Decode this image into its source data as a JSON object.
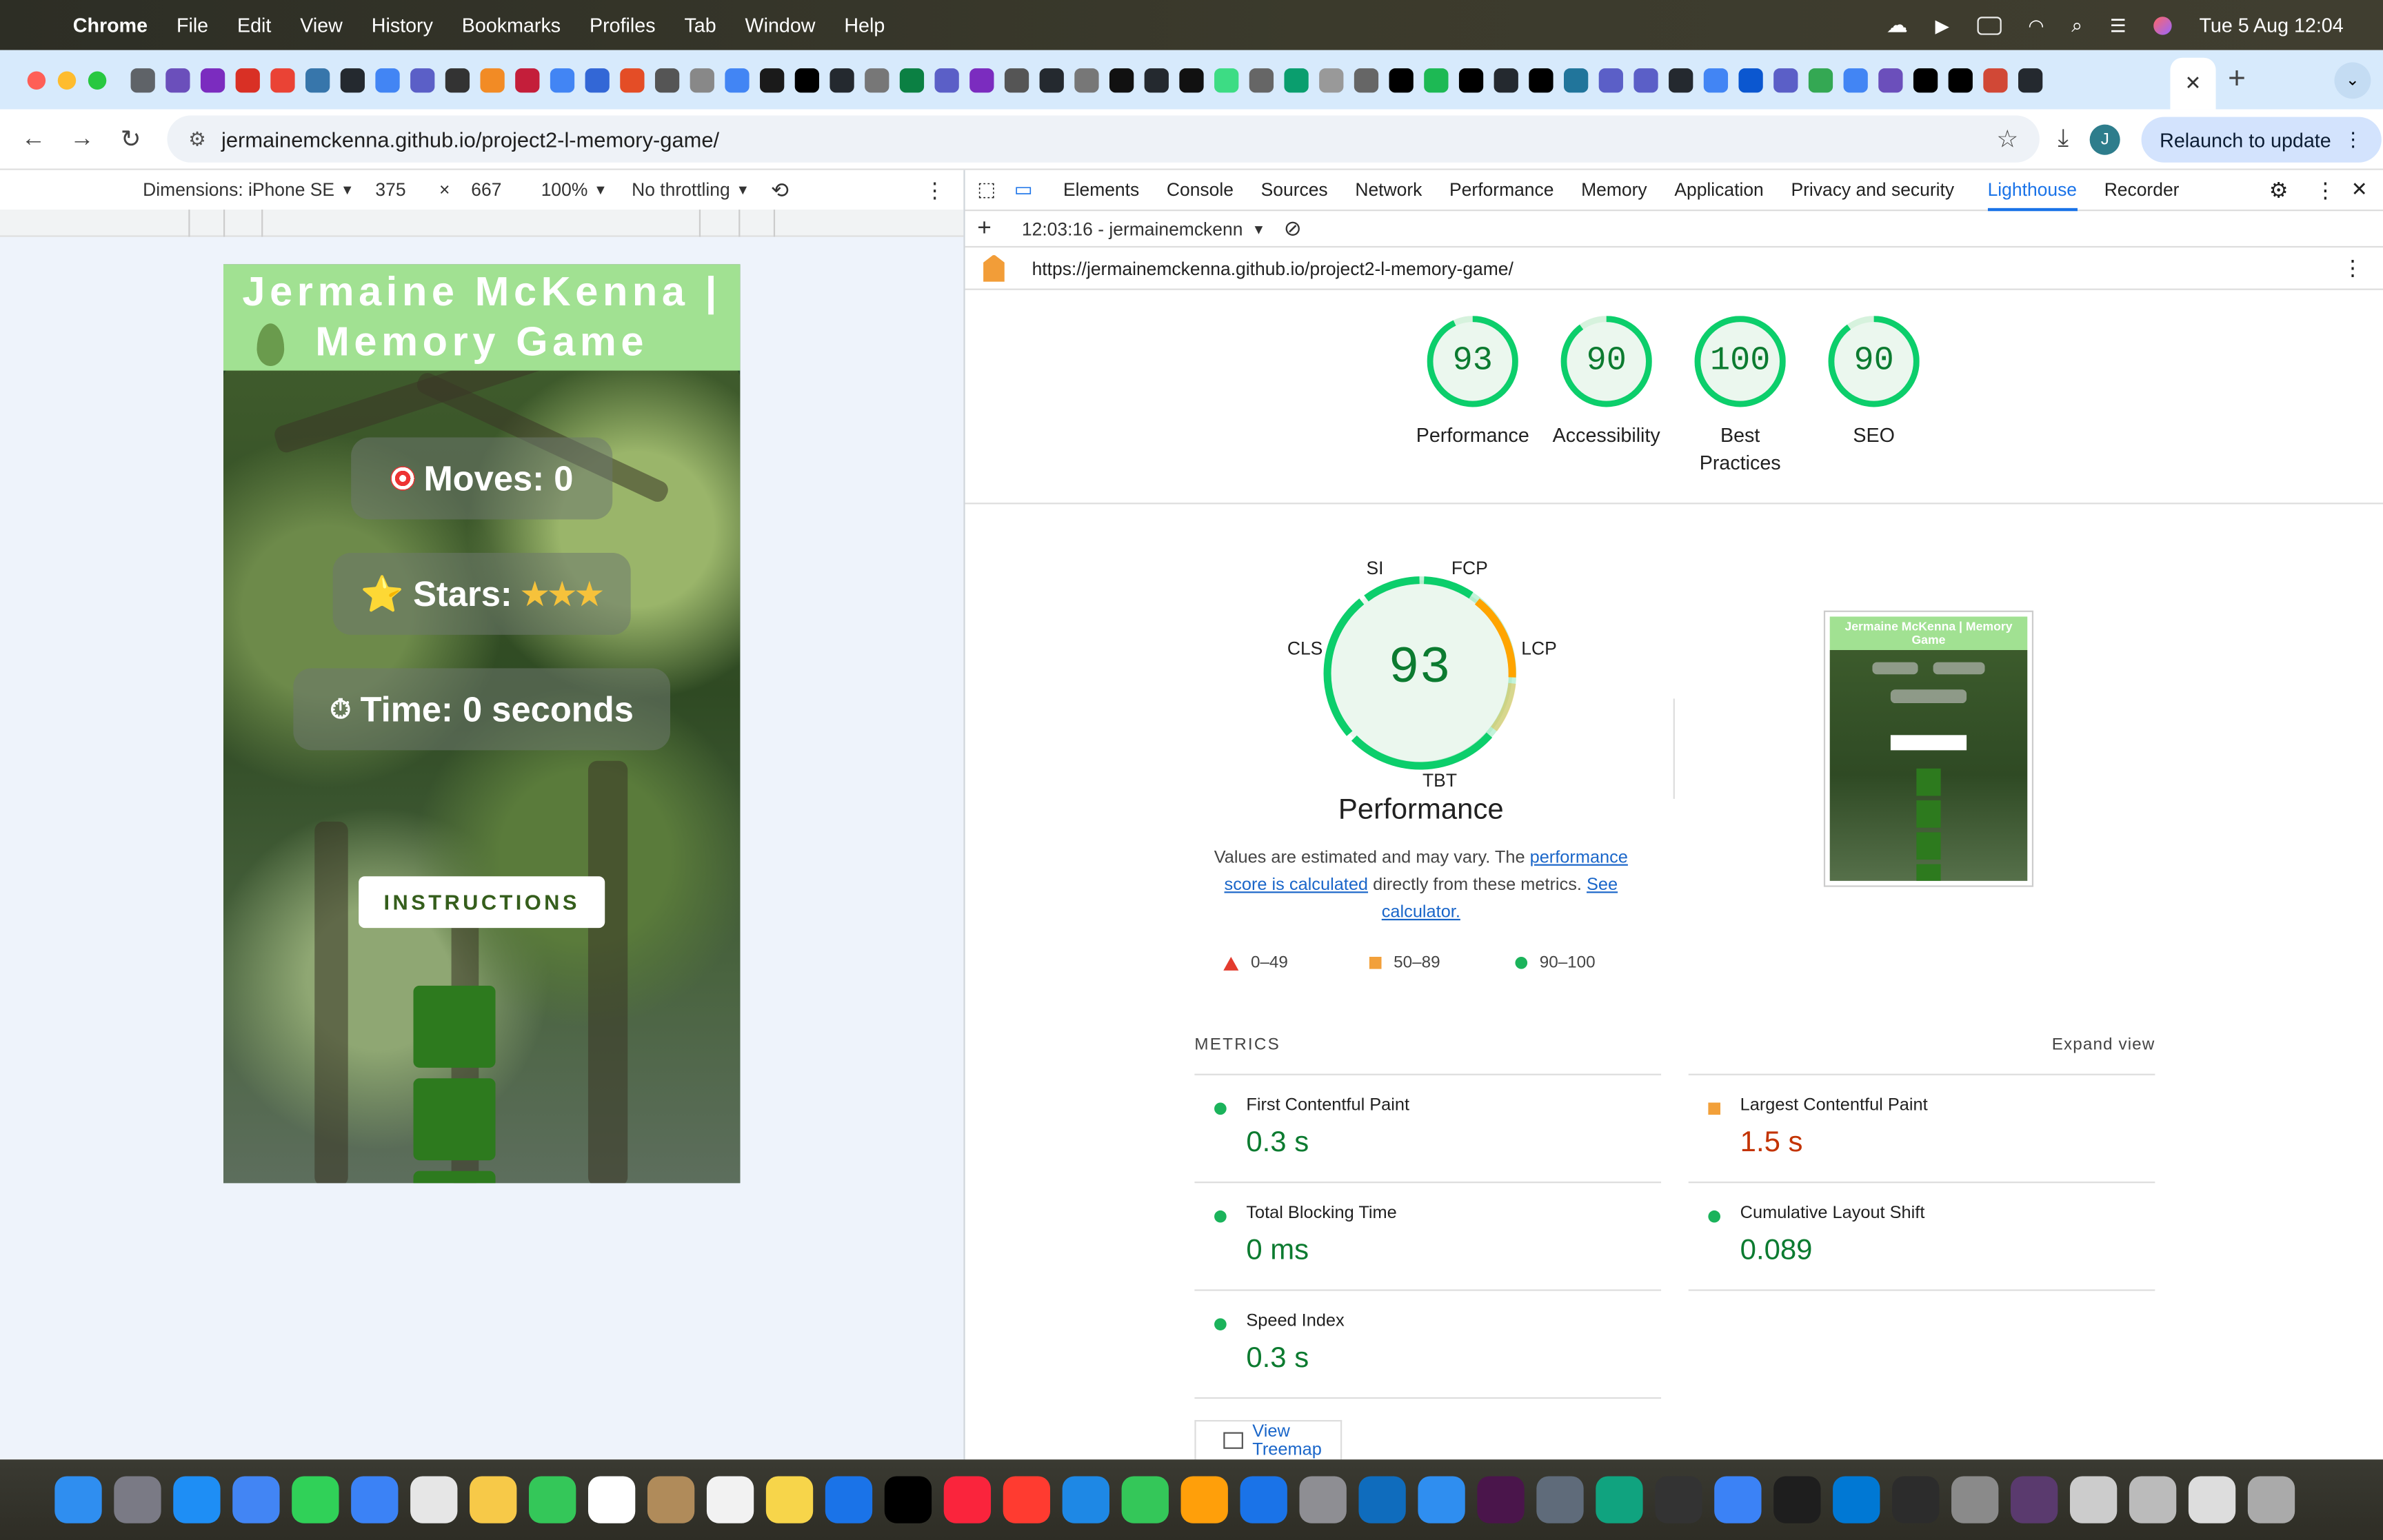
{
  "menubar": {
    "app": "Chrome",
    "items": [
      "File",
      "Edit",
      "View",
      "History",
      "Bookmarks",
      "Profiles",
      "Tab",
      "Window",
      "Help"
    ],
    "clock": "Tue 5 Aug  12:04"
  },
  "browser": {
    "url": "jermainemckenna.github.io/project2-l-memory-game/",
    "relaunch_label": "Relaunch to update",
    "profile_initial": "J",
    "active_tab_close": "✕"
  },
  "device_toolbar": {
    "dimensions_label": "Dimensions: iPhone SE",
    "width": "375",
    "times": "×",
    "height": "667",
    "zoom": "100%",
    "throttling": "No throttling"
  },
  "game": {
    "title_line1": "Jermaine McKenna |",
    "title_line2": "Memory Game",
    "moves": "Moves: 0",
    "stars_label": "Stars:",
    "stars_value": "★★★",
    "star_emoji": "⭐",
    "time": "Time: 0 seconds",
    "instructions": "INSTRUCTIONS"
  },
  "devtools": {
    "tabs": [
      "Elements",
      "Console",
      "Sources",
      "Network",
      "Performance",
      "Memory",
      "Application",
      "Privacy and security",
      "Lighthouse",
      "Recorder"
    ],
    "active_tab": "Lighthouse",
    "report_time": "12:03:16 - jermainemckenn",
    "report_url": "https://jermainemckenna.github.io/project2-l-memory-game/"
  },
  "lighthouse": {
    "scores": [
      {
        "value": "93",
        "label": "Performance",
        "fraction": 0.93
      },
      {
        "value": "90",
        "label": "Accessibility",
        "fraction": 0.9
      },
      {
        "value": "100",
        "label": "Best Practices",
        "fraction": 1.0
      },
      {
        "value": "90",
        "label": "SEO",
        "fraction": 0.9
      }
    ],
    "big_score": "93",
    "big_label": "Performance",
    "metric_abbrs": {
      "si": "SI",
      "fcp": "FCP",
      "lcp": "LCP",
      "tbt": "TBT",
      "cls": "CLS"
    },
    "desc_pre": "Values are estimated and may vary. The ",
    "desc_link1": "performance score is calculated",
    "desc_mid": " directly from these metrics. ",
    "desc_link2": "See calculator.",
    "legend": [
      "0–49",
      "50–89",
      "90–100"
    ],
    "screenshot_title": "Jermaine McKenna | Memory Game",
    "metrics_header": "METRICS",
    "expand_view": "Expand view",
    "metrics": [
      {
        "label": "First Contentful Paint",
        "value": "0.3 s",
        "status": "pass"
      },
      {
        "label": "Largest Contentful Paint",
        "value": "1.5 s",
        "status": "average"
      },
      {
        "label": "Total Blocking Time",
        "value": "0 ms",
        "status": "pass"
      },
      {
        "label": "Cumulative Layout Shift",
        "value": "0.089",
        "status": "pass"
      },
      {
        "label": "Speed Index",
        "value": "0.3 s",
        "status": "pass"
      }
    ],
    "treemap_label": "View Treemap"
  },
  "colors": {
    "pass": "#0c7b30",
    "average": "#c33300",
    "ring_green": "#0cce6b",
    "ring_orange": "#ffa400",
    "game_header": "#a1e192",
    "card_green": "#2d7a1e"
  }
}
